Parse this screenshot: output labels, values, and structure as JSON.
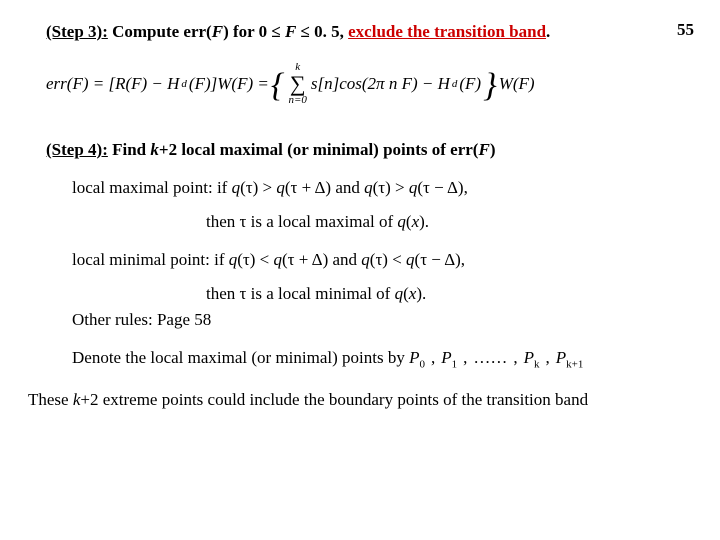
{
  "page_number": "55",
  "step3": {
    "label": "(Step 3):",
    "text_before_italic": " Compute err(",
    "F": "F",
    "text_mid": ") for 0 ≤ ",
    "F2": "F",
    "text_after": " ≤ 0. 5, ",
    "exclude": "exclude the transition band",
    "period": "."
  },
  "formula": {
    "lhs_open": "err(F) = [R(F) − H",
    "d": "d",
    "lhs_mid": "(F)]W(F) = ",
    "sum_top": "k",
    "sum_bot": "n=0",
    "inside1": "s[n]cos(2π n F) − H",
    "inside_d": "d",
    "inside2": "(F)",
    "tail": "W(F)"
  },
  "step4": {
    "label": "(Step 4):",
    "text1": " Find ",
    "k2": "k",
    "text2": "+2 local maximal (or minimal) points of err(",
    "F": "F",
    "text3": ")"
  },
  "local_max": {
    "lead": "local maximal point:  if ",
    "q": "q",
    "p1": "(τ) > ",
    "p2": "(τ + Δ) and ",
    "p3": "(τ) > ",
    "p4": "(τ − Δ),",
    "then": "then τ is a local maximal of ",
    "qx": "q",
    "tail": "(",
    "x": "x",
    "tail2": ")."
  },
  "local_min": {
    "lead": "local minimal point:  if ",
    "q": "q",
    "p1": "(τ) < ",
    "p2": "(τ + Δ) and ",
    "p3": "(τ) < ",
    "p4": "(τ − Δ),",
    "then": "then τ is a local minimal of ",
    "qx": "q",
    "tail": "(",
    "x": "x",
    "tail2": ")."
  },
  "other_rules": "Other rules:  Page 58",
  "denote": "Denote the local maximal (or minimal) points by",
  "points": {
    "P": "P",
    "s0": "0",
    "s1": "1",
    "dots": "……",
    "sk": "k",
    "sk1": "k+1",
    "comma": ","
  },
  "final": {
    "t1": "These ",
    "k2": "k",
    "t2": "+2 extreme points could include the boundary points of the transition band"
  }
}
